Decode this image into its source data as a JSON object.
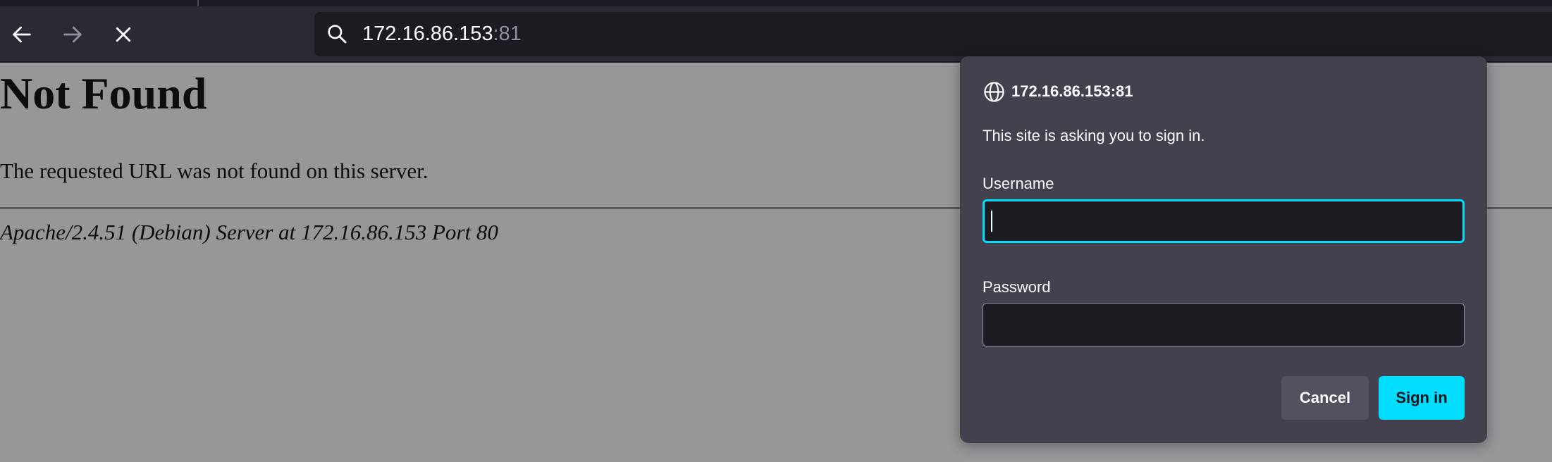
{
  "browser": {
    "url_host": "172.16.86.153",
    "url_port": ":81",
    "icons": {
      "back": "back-arrow-icon",
      "forward": "forward-arrow-icon",
      "stop": "close-icon",
      "search": "search-icon"
    }
  },
  "page": {
    "heading": "Not Found",
    "message": "The requested URL was not found on this server.",
    "address": "Apache/2.4.51 (Debian) Server at 172.16.86.153 Port 80"
  },
  "auth_dialog": {
    "origin": "172.16.86.153:81",
    "message": "This site is asking you to sign in.",
    "username_label": "Username",
    "username_value": "",
    "password_label": "Password",
    "password_value": "",
    "cancel_label": "Cancel",
    "signin_label": "Sign in",
    "colors": {
      "accent": "#00ddff",
      "dialog_bg": "#42414d",
      "input_bg": "#1c1b22"
    }
  }
}
